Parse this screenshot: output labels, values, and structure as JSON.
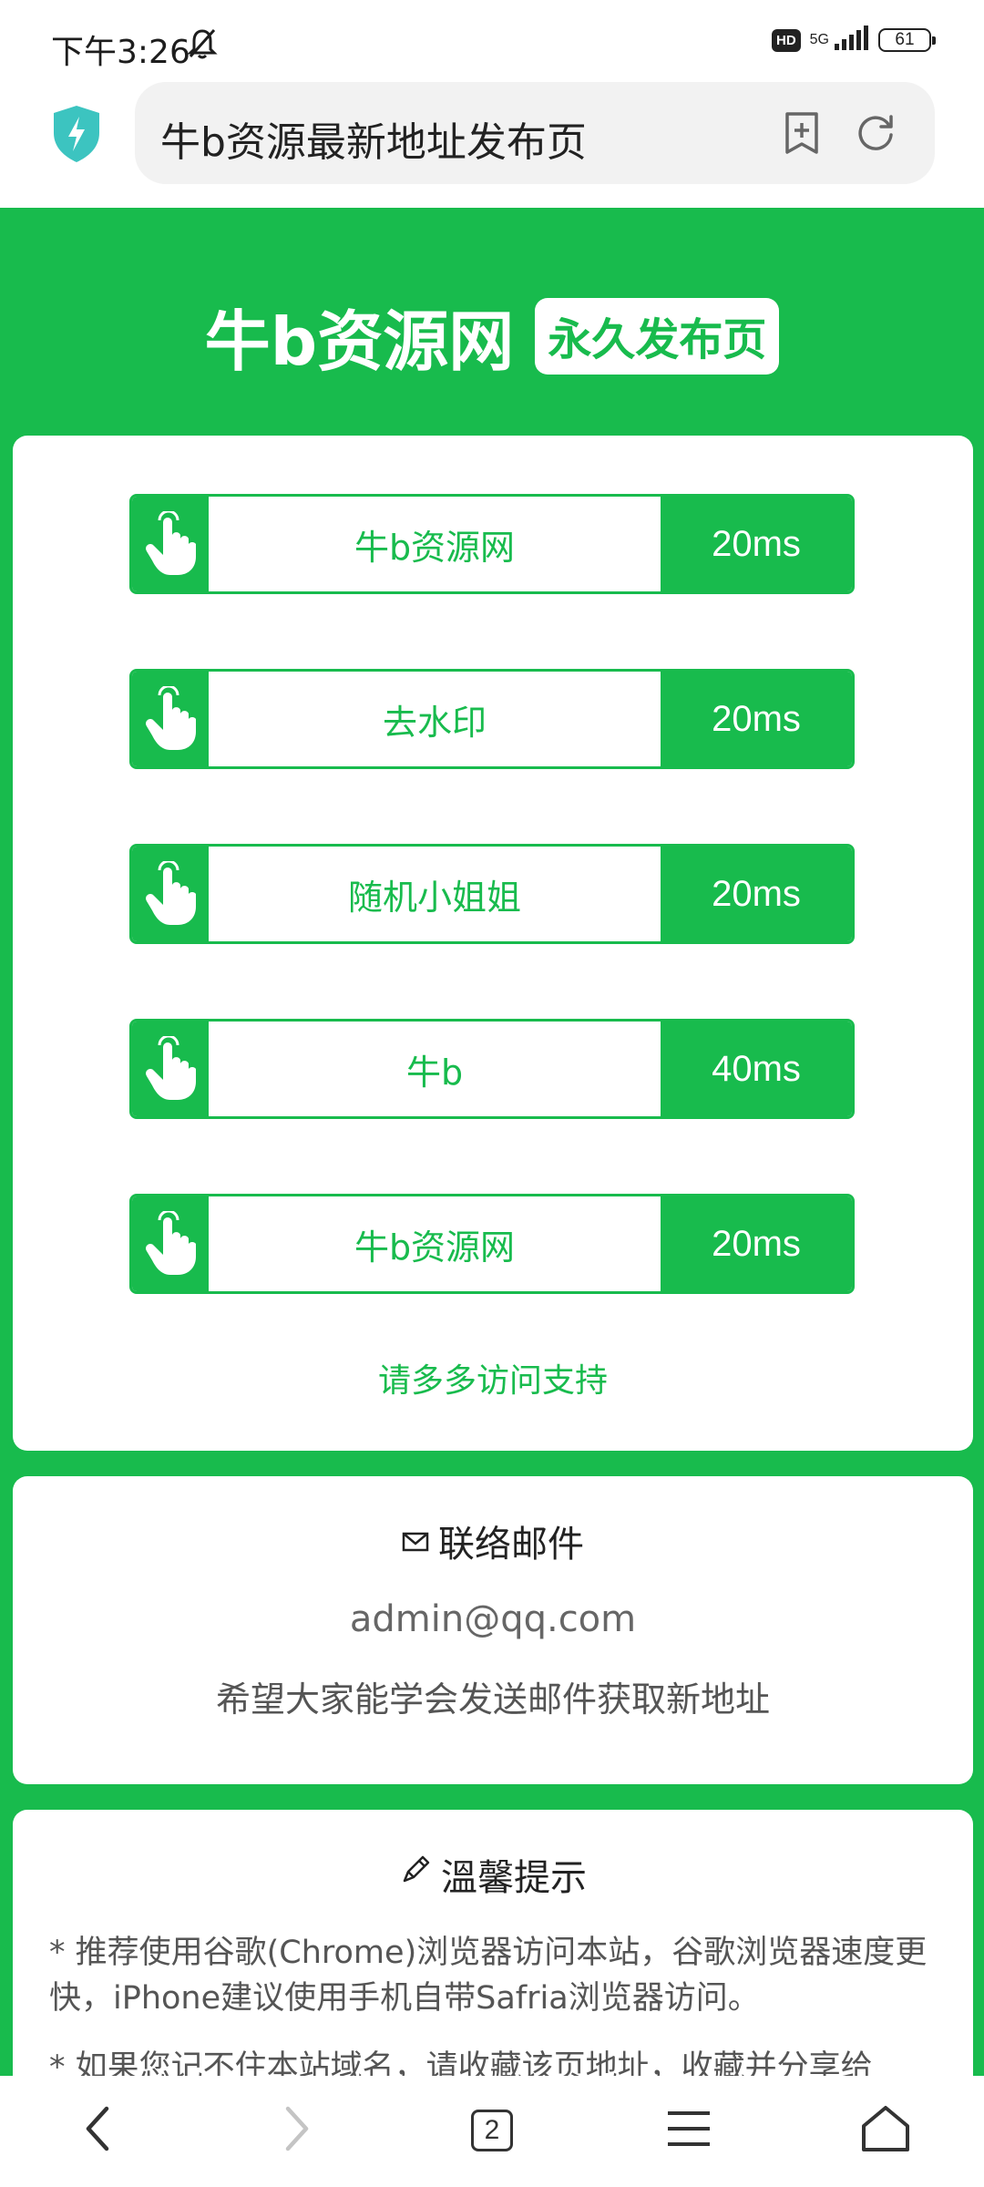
{
  "status_bar": {
    "time": "下午3:26",
    "hd_label": "HD",
    "network": "5G",
    "battery": "61"
  },
  "browser": {
    "url_title": "牛b资源最新地址发布页",
    "open_tabs": "2"
  },
  "hero": {
    "title": "牛b资源网",
    "badge": "永久发布页"
  },
  "links": [
    {
      "label": "牛b资源网",
      "ping": "20ms"
    },
    {
      "label": "去水印",
      "ping": "20ms"
    },
    {
      "label": "随机小姐姐",
      "ping": "20ms"
    },
    {
      "label": "牛b",
      "ping": "40ms"
    },
    {
      "label": "牛b资源网",
      "ping": "20ms"
    }
  ],
  "support_text": "请多多访问支持",
  "contact": {
    "heading": "联络邮件",
    "email": "admin@qq.com",
    "note": "希望大家能学会发送邮件获取新地址"
  },
  "tips": {
    "heading": "溫馨提示",
    "items": [
      "* 推荐使用谷歌(Chrome)浏览器访问本站，谷歌浏览器速度更快，iPhone建议使用手机自带Safria浏览器访问。",
      "* 如果您记不住本站域名，请收藏该页地址，收藏并分享给"
    ]
  },
  "colors": {
    "brand_green": "#18bb4d",
    "shield": "#3cc4c0"
  }
}
